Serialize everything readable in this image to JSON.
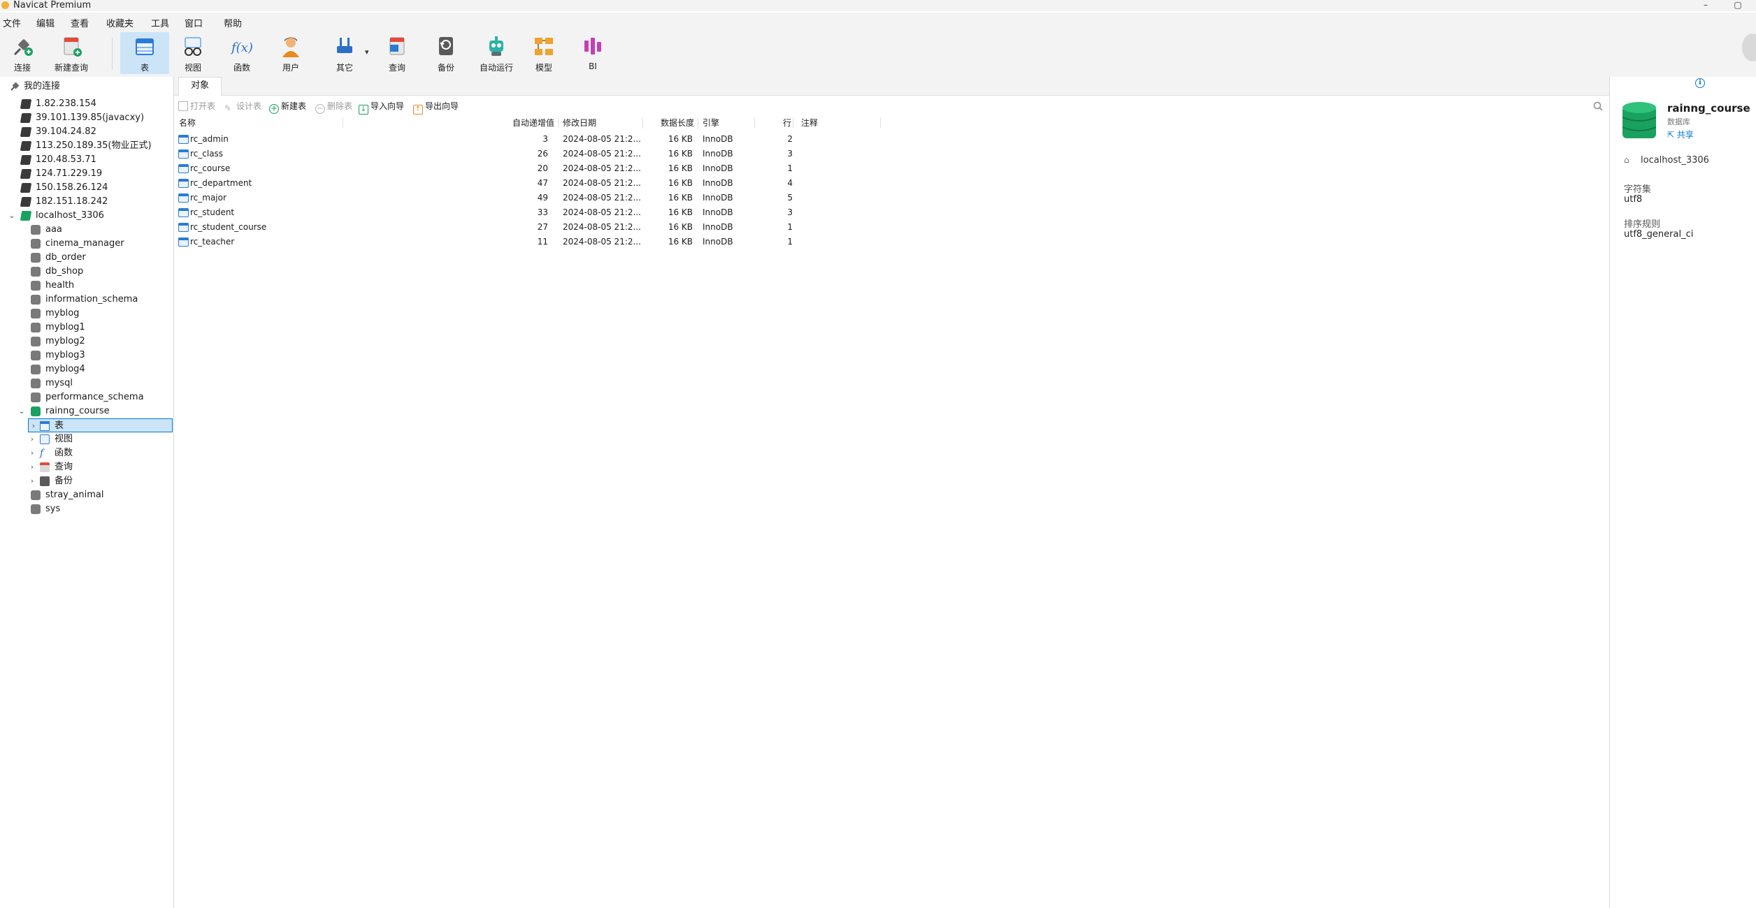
{
  "window": {
    "title": "Navicat Premium",
    "minimize": "–",
    "maximize": "▢"
  },
  "menu": [
    "文件",
    "编辑",
    "查看",
    "收藏夹",
    "工具",
    "窗口",
    "帮助"
  ],
  "toolbar": [
    {
      "label": "连接",
      "icon": "plug-icon"
    },
    {
      "label": "新建查询",
      "icon": "new-query-icon"
    },
    {
      "label": "表",
      "icon": "table-icon",
      "active": true
    },
    {
      "label": "视图",
      "icon": "view-icon"
    },
    {
      "label": "函数",
      "icon": "function-icon",
      "glyph": "f(x)"
    },
    {
      "label": "用户",
      "icon": "user-icon"
    },
    {
      "label": "其它",
      "icon": "tools-icon",
      "dropdown": "▾"
    },
    {
      "label": "查询",
      "icon": "query-icon"
    },
    {
      "label": "备份",
      "icon": "backup-icon"
    },
    {
      "label": "自动运行",
      "icon": "robot-icon"
    },
    {
      "label": "模型",
      "icon": "model-icon"
    },
    {
      "label": "BI",
      "icon": "bi-icon"
    }
  ],
  "sidebar": {
    "root": "我的连接",
    "connections": [
      "1.82.238.154",
      "39.101.139.85(javacxy)",
      "39.104.24.82",
      "113.250.189.35(物业正式)",
      "120.48.53.71",
      "124.71.229.19",
      "150.158.26.124",
      "182.151.18.242"
    ],
    "open_connection": "localhost_3306",
    "databases_before": [
      "aaa",
      "cinema_manager",
      "db_order",
      "db_shop",
      "health",
      "information_schema",
      "myblog",
      "myblog1",
      "myblog2",
      "myblog3",
      "myblog4",
      "mysql",
      "performance_schema"
    ],
    "open_database": "rainng_course",
    "children": [
      "表",
      "视图",
      "函数",
      "查询",
      "备份"
    ],
    "databases_after": [
      "stray_animal",
      "sys"
    ]
  },
  "tab": {
    "label": "对象"
  },
  "object_toolbar": {
    "open": "打开表",
    "design": "设计表",
    "new": "新建表",
    "delete": "删除表",
    "import": "导入向导",
    "export": "导出向导"
  },
  "table": {
    "headers": {
      "name": "名称",
      "auto_inc": "自动递增值",
      "modified": "修改日期",
      "data_length": "数据长度",
      "engine": "引擎",
      "rows": "行",
      "comment": "注释"
    },
    "rows": [
      {
        "name": "rc_admin",
        "auto_inc": "3",
        "modified": "2024-08-05 21:2...",
        "data_length": "16 KB",
        "engine": "InnoDB",
        "rows": "2"
      },
      {
        "name": "rc_class",
        "auto_inc": "26",
        "modified": "2024-08-05 21:2...",
        "data_length": "16 KB",
        "engine": "InnoDB",
        "rows": "3"
      },
      {
        "name": "rc_course",
        "auto_inc": "20",
        "modified": "2024-08-05 21:2...",
        "data_length": "16 KB",
        "engine": "InnoDB",
        "rows": "1"
      },
      {
        "name": "rc_department",
        "auto_inc": "47",
        "modified": "2024-08-05 21:2...",
        "data_length": "16 KB",
        "engine": "InnoDB",
        "rows": "4"
      },
      {
        "name": "rc_major",
        "auto_inc": "49",
        "modified": "2024-08-05 21:2...",
        "data_length": "16 KB",
        "engine": "InnoDB",
        "rows": "5"
      },
      {
        "name": "rc_student",
        "auto_inc": "33",
        "modified": "2024-08-05 21:2...",
        "data_length": "16 KB",
        "engine": "InnoDB",
        "rows": "3"
      },
      {
        "name": "rc_student_course",
        "auto_inc": "27",
        "modified": "2024-08-05 21:2...",
        "data_length": "16 KB",
        "engine": "InnoDB",
        "rows": "1"
      },
      {
        "name": "rc_teacher",
        "auto_inc": "11",
        "modified": "2024-08-05 21:2...",
        "data_length": "16 KB",
        "engine": "InnoDB",
        "rows": "1"
      }
    ]
  },
  "info": {
    "db_name": "rainng_course",
    "db_type": "数据库",
    "share": "共享",
    "connection": "localhost_3306",
    "charset_label": "字符集",
    "charset": "utf8",
    "collation_label": "排序规则",
    "collation": "utf8_general_ci"
  },
  "colors": {
    "accent": "#0078d7",
    "selected_bg": "#cce4f7",
    "db_open": "#19a15f"
  }
}
